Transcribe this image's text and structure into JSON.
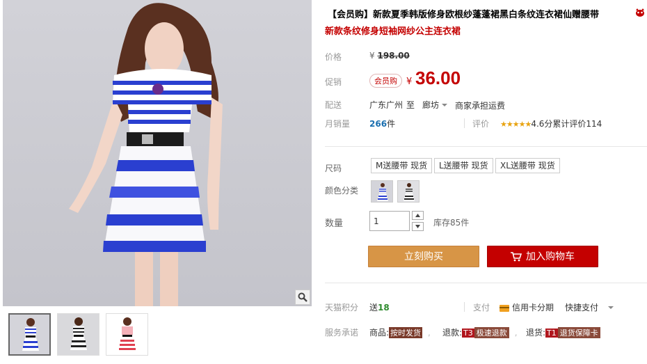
{
  "product": {
    "title": "【会员购】新款夏季韩版修身欧根纱蓬蓬裙黑白条纹连衣裙仙赠腰带",
    "subtitle": "新款条纹修身短袖网纱公主连衣裙"
  },
  "price": {
    "label": "价格",
    "currency": "¥",
    "original": "198.00"
  },
  "promo": {
    "label": "促销",
    "badge": "会员购",
    "currency": "¥",
    "price": "36.00"
  },
  "shipping": {
    "label": "配送",
    "from": "广东广州",
    "to_word": "至",
    "destination": "廊坊",
    "fee": "商家承担运费"
  },
  "sales": {
    "label": "月销量",
    "count": "266",
    "unit": "件",
    "rating_label": "评价",
    "stars": "★★★★★",
    "rating_score": "4.6分",
    "reviews": "累计评价114"
  },
  "size": {
    "label": "尺码",
    "options": [
      "M送腰带 现货",
      "L送腰带 现货",
      "XL送腰带 现货"
    ]
  },
  "color": {
    "label": "颜色分类"
  },
  "quantity": {
    "label": "数量",
    "value": "1",
    "stock": "库存85件"
  },
  "buttons": {
    "buy": "立刻购买",
    "cart": "加入购物车"
  },
  "points": {
    "label": "天猫积分",
    "text": "送",
    "value": "18"
  },
  "payment": {
    "label": "支付",
    "card": "信用卡分期",
    "express": "快捷支付"
  },
  "service": {
    "label": "服务承诺",
    "goods": "商品:",
    "goods_tag": "按时发货",
    "refund": "退款:",
    "refund_code": "T3",
    "refund_tag": "极速退款",
    "return": "退货:",
    "return_code": "T1",
    "return_tag": "退货保障卡"
  },
  "colors": {
    "accent_red": "#c40000",
    "buy_button": "#d79546",
    "cart_button": "#c40000",
    "stripe_blue": "#2a3fd0"
  }
}
